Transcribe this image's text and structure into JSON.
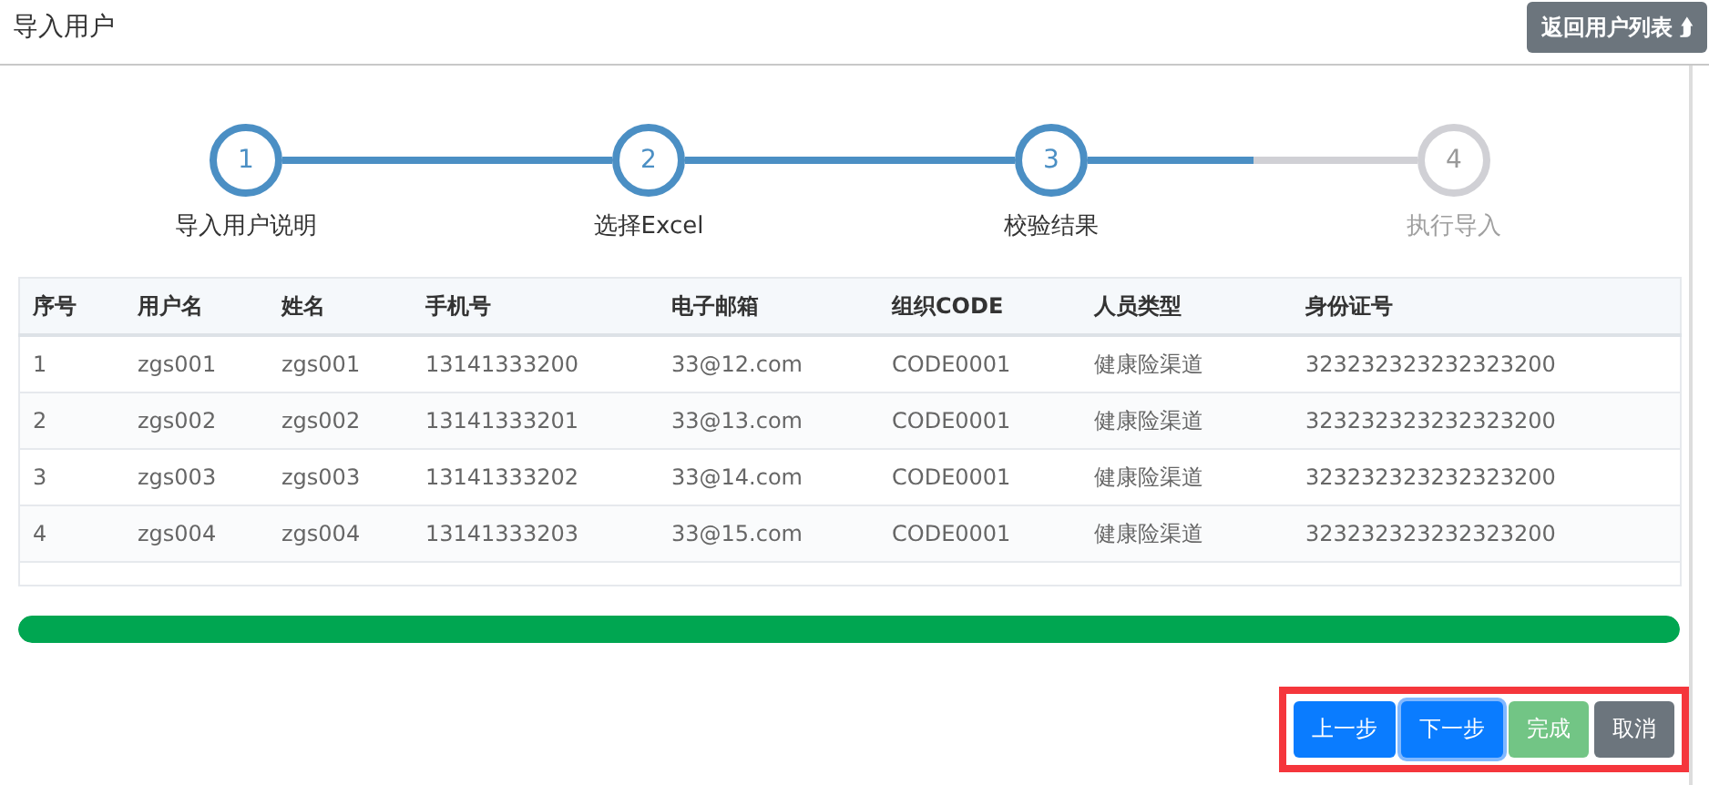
{
  "header": {
    "title": "导入用户",
    "back_button": {
      "label": "返回用户列表",
      "icon": "⮭"
    }
  },
  "steps": [
    {
      "number": "1",
      "label": "导入用户说明",
      "done": true,
      "level": 1
    },
    {
      "number": "2",
      "label": "选择Excel",
      "done": true,
      "level": 1
    },
    {
      "number": "3",
      "label": "校验结果",
      "done": true,
      "level": 0.5
    },
    {
      "number": "4",
      "label": "执行导入",
      "done": false
    }
  ],
  "table": {
    "columns": [
      "序号",
      "用户名",
      "姓名",
      "手机号",
      "电子邮箱",
      "组织CODE",
      "人员类型",
      "身份证号"
    ],
    "rows": [
      [
        "1",
        "zgs001",
        "zgs001",
        "13141333200",
        "33@12.com",
        "CODE0001",
        "健康险渠道",
        "323232323232323200"
      ],
      [
        "2",
        "zgs002",
        "zgs002",
        "13141333201",
        "33@13.com",
        "CODE0001",
        "健康险渠道",
        "323232323232323200"
      ],
      [
        "3",
        "zgs003",
        "zgs003",
        "13141333202",
        "33@14.com",
        "CODE0001",
        "健康险渠道",
        "323232323232323200"
      ],
      [
        "4",
        "zgs004",
        "zgs004",
        "13141333203",
        "33@15.com",
        "CODE0001",
        "健康险渠道",
        "323232323232323200"
      ]
    ]
  },
  "progress": {
    "level": 1
  },
  "buttons": [
    {
      "label": "上一步",
      "kind": "primary",
      "disabled": false,
      "focused": false
    },
    {
      "label": "下一步",
      "kind": "primary",
      "disabled": false,
      "focused": true
    },
    {
      "label": "完成",
      "kind": "success",
      "disabled": true,
      "focused": false
    },
    {
      "label": "取消",
      "kind": "secondary",
      "disabled": false,
      "focused": false
    }
  ],
  "highlight": true
}
